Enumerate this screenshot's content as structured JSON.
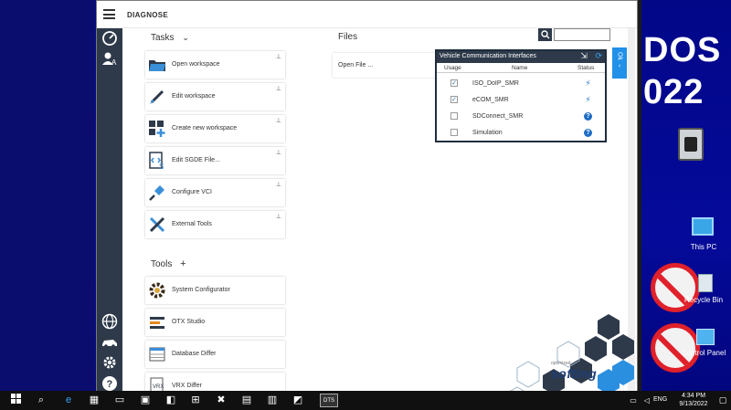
{
  "app": {
    "title": "DIAGNOSE"
  },
  "tasks": {
    "title": "Tasks",
    "items": [
      {
        "label": "Open workspace",
        "icon": "folder-icon"
      },
      {
        "label": "Edit workspace",
        "icon": "brush-icon"
      },
      {
        "label": "Create new workspace",
        "icon": "grid-add-icon"
      },
      {
        "label": "Edit SGDE File...",
        "icon": "code-file-icon"
      },
      {
        "label": "Configure VCI",
        "icon": "plug-icon"
      },
      {
        "label": "External Tools",
        "icon": "tools-icon"
      }
    ]
  },
  "tools": {
    "title": "Tools",
    "add_symbol": "+",
    "items": [
      {
        "label": "System Configurator",
        "icon": "gear-icon"
      },
      {
        "label": "OTX Studio",
        "icon": "otx-icon"
      },
      {
        "label": "Database Differ",
        "icon": "database-icon"
      },
      {
        "label": "VRX Differ",
        "icon": "vrx-file-icon"
      }
    ]
  },
  "files": {
    "title": "Files",
    "open_file_label": "Open File ..."
  },
  "search": {
    "placeholder": ""
  },
  "vci": {
    "title": "Vehicle Communication Interfaces",
    "columns": {
      "usage": "Usage",
      "name": "Name",
      "status": "Status"
    },
    "rows": [
      {
        "name": "ISO_DoIP_SMR",
        "checked": true,
        "status": "connected"
      },
      {
        "name": "eCOM_SMR",
        "checked": true,
        "status": "connected"
      },
      {
        "name": "SDConnect_SMR",
        "checked": false,
        "status": "unknown"
      },
      {
        "name": "Simulation",
        "checked": false,
        "status": "unknown"
      }
    ]
  },
  "side_tab": {
    "label": "Ok"
  },
  "brand": {
    "name": "softing",
    "tagline": "optimized"
  },
  "desktop": {
    "big_text_1": "DOS",
    "big_text_2": "022",
    "icon_this_pc": "This PC",
    "icon_recycle_bin": "Recycle Bin",
    "icon_control_panel": "Control Panel"
  },
  "taskbar": {
    "language": "ENG",
    "time": "4:34 PM",
    "date": "9/13/2022",
    "dts_label": "DTS"
  },
  "colors": {
    "rail": "#2e3a4a",
    "accent_blue": "#2190e8",
    "desktop_blue": "#04088a"
  }
}
